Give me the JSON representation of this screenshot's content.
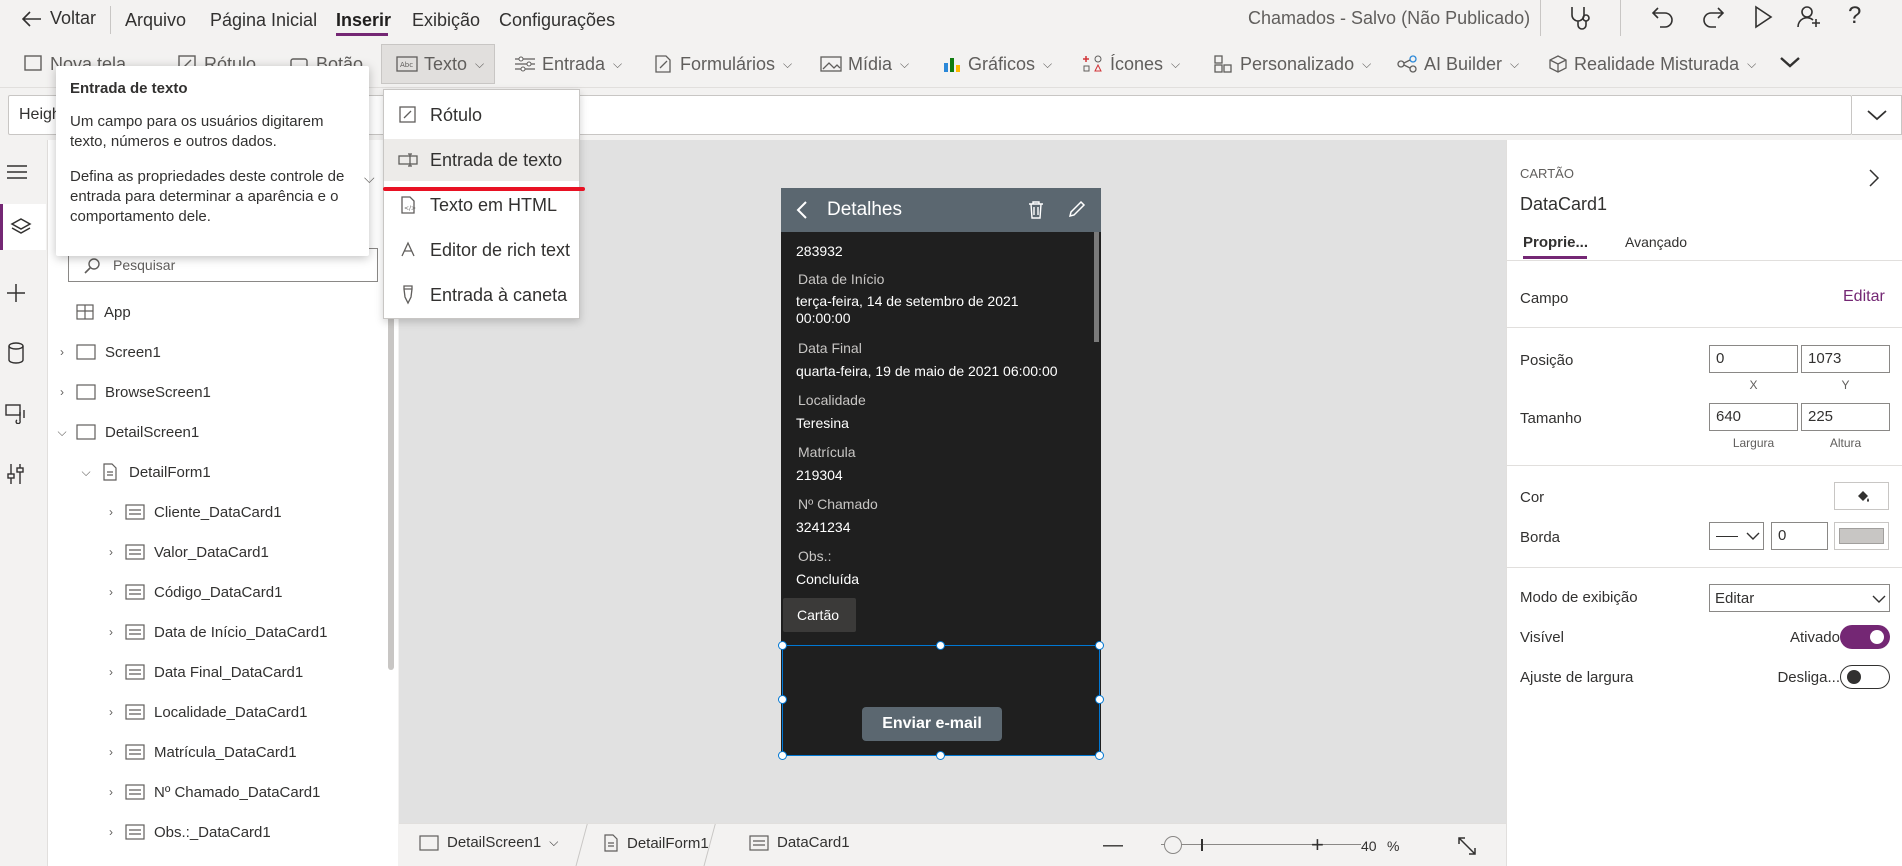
{
  "topbar": {
    "back_label": "Voltar",
    "menus": [
      "Arquivo",
      "Página Inicial",
      "Inserir",
      "Exibição",
      "Configurações"
    ],
    "active_menu": "Inserir",
    "app_status": "Chamados - Salvo (Não Publicado)"
  },
  "ribbon": {
    "new_screen": "Nova tela",
    "label": "Rótulo",
    "button": "Botão",
    "text": "Texto",
    "input": "Entrada",
    "forms": "Formulários",
    "media": "Mídia",
    "charts": "Gráficos",
    "icons": "Ícones",
    "custom": "Personalizado",
    "ai_builder": "AI Builder",
    "mixed_reality": "Realidade Misturada"
  },
  "formula": {
    "property": "Height"
  },
  "tooltip": {
    "title": "Entrada de texto",
    "para1": "Um campo para os usuários digitarem texto, números e outros dados.",
    "para2": "Defina as propriedades deste controle de entrada para determinar a aparência e o comportamento dele."
  },
  "dropdown": {
    "items": [
      "Rótulo",
      "Entrada de texto",
      "Texto em HTML",
      "Editor de rich text",
      "Entrada à caneta"
    ],
    "highlighted": "Entrada de texto"
  },
  "tree": {
    "search_placeholder": "Pesquisar",
    "items": [
      {
        "label": "App",
        "level": 0
      },
      {
        "label": "Screen1",
        "level": 0
      },
      {
        "label": "BrowseScreen1",
        "level": 0
      },
      {
        "label": "DetailScreen1",
        "level": 0
      },
      {
        "label": "DetailForm1",
        "level": 1
      },
      {
        "label": "Cliente_DataCard1",
        "level": 2
      },
      {
        "label": "Valor_DataCard1",
        "level": 2
      },
      {
        "label": "Código_DataCard1",
        "level": 2
      },
      {
        "label": "Data de Início_DataCard1",
        "level": 2
      },
      {
        "label": "Data Final_DataCard1",
        "level": 2
      },
      {
        "label": "Localidade_DataCard1",
        "level": 2
      },
      {
        "label": "Matrícula_DataCard1",
        "level": 2
      },
      {
        "label": "Nº Chamado_DataCard1",
        "level": 2
      },
      {
        "label": "Obs.:_DataCard1",
        "level": 2
      }
    ]
  },
  "phone": {
    "title": "Detalhes",
    "first_value": "283932",
    "fields": [
      {
        "label": "Data de Início",
        "value": "terça-feira, 14 de setembro de 2021 00:00:00"
      },
      {
        "label": "Data Final",
        "value": "quarta-feira, 19 de maio de 2021 06:00:00"
      },
      {
        "label": "Localidade",
        "value": "Teresina"
      },
      {
        "label": "Matrícula",
        "value": "219304"
      },
      {
        "label": "Nº Chamado",
        "value": "3241234"
      },
      {
        "label": "Obs.:",
        "value": "Concluída"
      }
    ],
    "card_tooltip": "Cartão",
    "email_button": "Enviar e-mail"
  },
  "bottombar": {
    "screen": "DetailScreen1",
    "form": "DetailForm1",
    "card": "DataCard1",
    "zoom": "40",
    "zoom_unit": "%"
  },
  "rpanel": {
    "type": "CARTÃO",
    "name": "DataCard1",
    "tab_properties": "Proprie...",
    "tab_advanced": "Avançado",
    "field_label": "Campo",
    "edit_link": "Editar",
    "position_label": "Posição",
    "pos_x": "0",
    "pos_y": "1073",
    "x_label": "X",
    "y_label": "Y",
    "size_label": "Tamanho",
    "width": "640",
    "height": "225",
    "width_label": "Largura",
    "height_label": "Altura",
    "color_label": "Cor",
    "border_label": "Borda",
    "border_width": "0",
    "display_mode_label": "Modo de exibição",
    "display_mode": "Editar",
    "visible_label": "Visível",
    "visible_state": "Ativado",
    "width_fit_label": "Ajuste de largura",
    "width_fit_state": "Desliga..."
  },
  "colors": {
    "accent": "#742774",
    "phone_header": "#5b6770",
    "phone_bg": "#1f1f1f",
    "red_mark": "#e81123",
    "selection": "#0078d4"
  }
}
